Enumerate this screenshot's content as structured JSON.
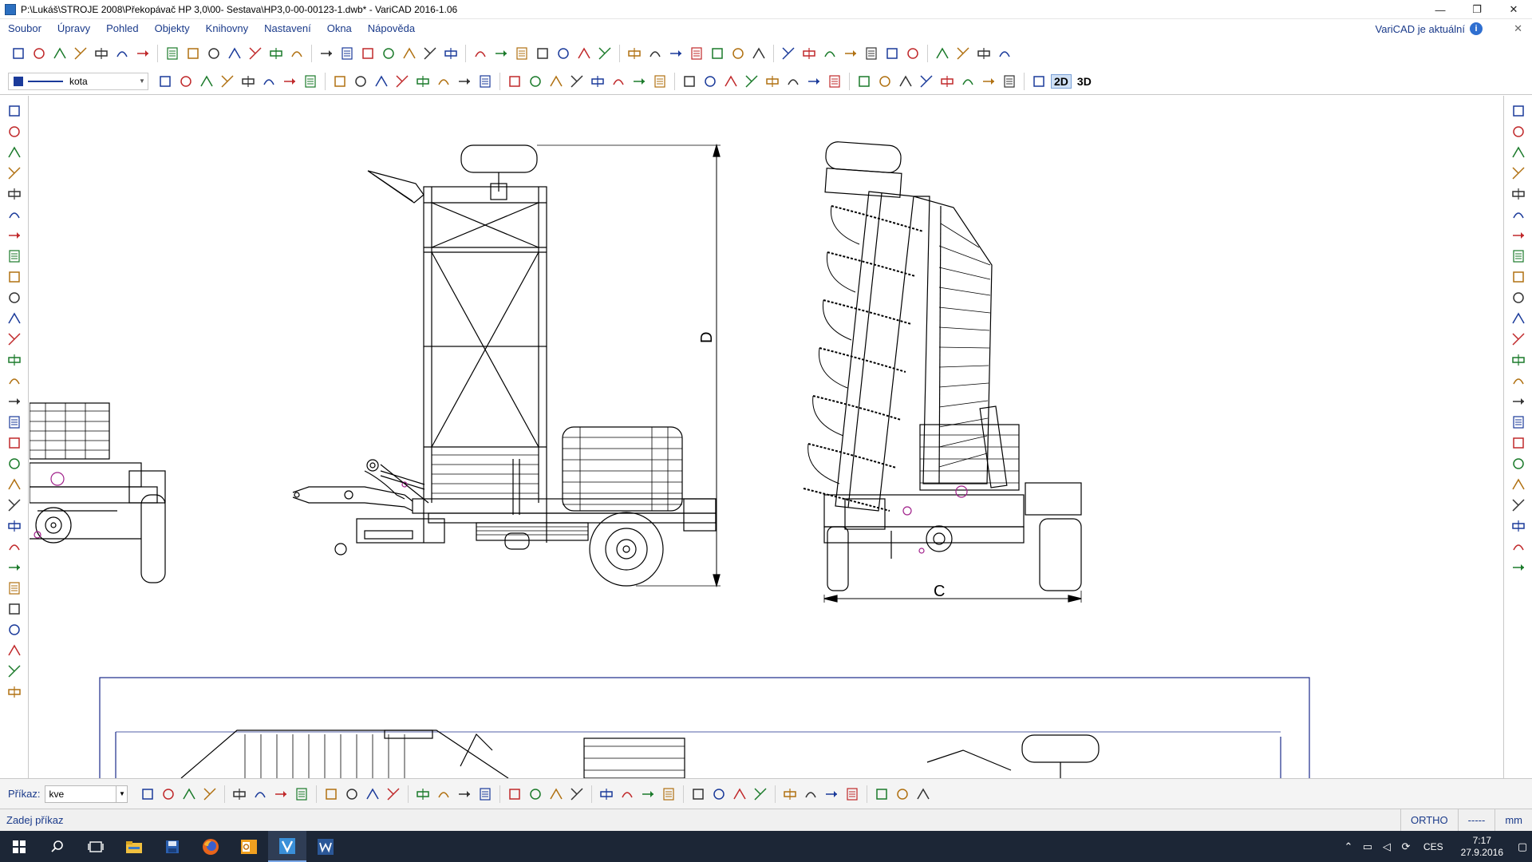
{
  "window": {
    "title": "P:\\Lukáš\\STROJE 2008\\Překopávač HP 3,0\\00- Sestava\\HP3,0-00-00123-1.dwb* - VariCAD 2016-1.06",
    "controls": [
      "—",
      "❐",
      "✕"
    ]
  },
  "menu": {
    "items": [
      "Soubor",
      "Úpravy",
      "Pohled",
      "Objekty",
      "Knihovny",
      "Nastavení",
      "Okna",
      "Nápověda"
    ],
    "update_status": "VariCAD je aktuální",
    "close": "✕"
  },
  "toolbar": {
    "layer_name": "kota",
    "mode_2d": "2D",
    "mode_3d": "3D"
  },
  "icons": {
    "toolbar1": [
      "new-file-icon",
      "open-file-icon",
      "save-icon",
      "save-all-icon",
      "print-icon",
      "copy-icon",
      "paste-icon",
      "undo-icon",
      "redo-icon",
      "polyline-icon",
      "rectangle-icon",
      "mirror-shape-icon",
      "polygon-icon",
      "hatch-icon",
      "arrow-shape-icon",
      "insert-block-icon",
      "crosshair-icon",
      "ellipse-icon",
      "rotate-icon",
      "snap-center-icon",
      "snap-radius-icon",
      "circle-icon",
      "circle-tangent-icon",
      "arc-icon",
      "arc-circle-icon",
      "chain-icon",
      "snap-end-icon",
      "snap-rotate-icon",
      "spiral-icon",
      "curve-icon",
      "angle-icon",
      "edit-pencil-icon",
      "hatch-pattern-icon",
      "table-icon",
      "block-edit-icon",
      "keyboard-icon",
      "box-3d-icon",
      "cross-3d-icon",
      "solid-icon",
      "assembly-icon",
      "spring-icon",
      "zigzag-icon",
      "bent-icon",
      "shapes-icon",
      "disp-2-icon",
      "disp-1-icon"
    ],
    "toolbar2": [
      "layer-manage-icon",
      "select-window-icon",
      "select-all-icon",
      "move-icon",
      "move-multi-icon",
      "move-point-icon",
      "stretch-icon",
      "scale-icon",
      "delete-icon",
      "move-copy-icon",
      "transform-icon",
      "grid-icon",
      "point-icon",
      "vertex-icon",
      "dots-icon",
      "cluster-icon",
      "ellipse-tool-icon",
      "curve-tool-icon",
      "brush-icon",
      "text-box-icon",
      "text-icon",
      "text-edit-icon",
      "text-frame-icon",
      "text-layer-icon",
      "text-vertical-icon",
      "text-scale-icon",
      "text-measure-icon",
      "font-icon",
      "check-icon",
      "query-icon",
      "distance-icon",
      "angle-measure-icon",
      "point-measure-icon",
      "layers-icon",
      "edit-object-icon",
      "zoom-window-icon",
      "zoom-out-icon",
      "zoom-all-icon",
      "zoom-previous-icon",
      "zoom-in-icon",
      "pan-icon"
    ],
    "left": [
      "delete-x-icon",
      "delete-all-icon",
      "split-vertical-icon",
      "split-mirror-icon",
      "split-horizontal-icon",
      "split-cross-icon",
      "extend-icon",
      "fillet-icon",
      "arc-edit-icon",
      "corner-icon",
      "measure-bar-icon",
      "align-icon",
      "hatch-edit-icon",
      "stretch-left-icon",
      "offset-icon",
      "copy-left-icon",
      "copy-multi-icon",
      "rotate-left-icon",
      "rotate-copy-icon",
      "scale-left-icon",
      "frame-left-icon",
      "mirror-left-icon",
      "explode-icon",
      "group-icon",
      "array-icon",
      "break-icon",
      "join-icon",
      "block-array-icon",
      "paint-icon"
    ],
    "right": [
      "dim-linear-icon",
      "dim-horizontal-icon",
      "dim-vertical-icon",
      "dim-aligned-icon",
      "dim-two-icon",
      "dim-circle-icon",
      "dim-radius-icon",
      "dim-diameter-icon",
      "dim-arc-icon",
      "dim-table-icon",
      "dim-table-edit-icon",
      "dim-angle-icon",
      "dim-angle-two-icon",
      "dim-chain-icon",
      "dim-chain-two-icon",
      "dim-chain-three-icon",
      "dim-level-icon",
      "dim-level-two-icon",
      "dim-remove-icon",
      "dim-edit-icon",
      "dim-delete-icon",
      "dim-slash-icon",
      "dim-slash-two-icon"
    ],
    "bottom": [
      "dim-h-icon",
      "dim-h2-icon",
      "dim-h3-icon",
      "dim-h4-icon",
      "dim-v-icon",
      "dim-v2-icon",
      "dim-v3-icon",
      "dim-v4-icon",
      "dim-a-icon",
      "dim-a2-icon",
      "dim-a3-icon",
      "dim-a4-icon",
      "dim-dia-icon",
      "dim-rad-icon",
      "dim-ang-icon",
      "dim-box-icon",
      "dim-box2-icon",
      "dim-box3-icon",
      "dim-box4-icon",
      "dim-box5-icon",
      "dim-box6-icon",
      "dim-check-icon",
      "dim-check2-icon",
      "dim-note-icon",
      "dim-label-icon",
      "dim-label2-icon",
      "dim-label3-icon",
      "dim-arrow-icon",
      "tol-icon",
      "tol2-icon",
      "tol3-icon",
      "tol4-icon",
      "color-icon",
      "color2-icon",
      "monitor-icon"
    ]
  },
  "drawing": {
    "dimension_labels": {
      "height": "D",
      "width": "C"
    }
  },
  "command": {
    "label": "Příkaz:",
    "value": "kve"
  },
  "status": {
    "prompt": "Zadej příkaz",
    "ortho": "ORTHO",
    "snap": "-----",
    "units": "mm"
  },
  "taskbar": {
    "apps": [
      "start-icon",
      "search-icon",
      "task-view-icon",
      "file-explorer-icon",
      "varicad-save-icon",
      "firefox-icon",
      "outlook-icon",
      "varicad-icon",
      "word-icon"
    ],
    "tray_lang": "CES",
    "time": "7:17",
    "date": "27.9.2016"
  }
}
